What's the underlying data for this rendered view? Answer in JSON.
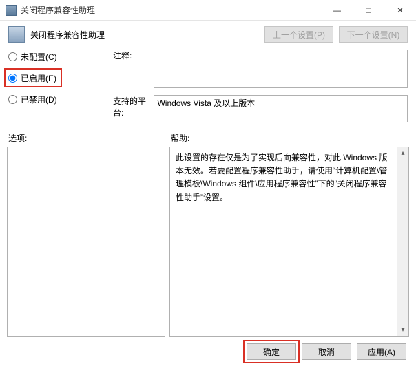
{
  "window": {
    "title": "关闭程序兼容性助理"
  },
  "header": {
    "title": "关闭程序兼容性助理",
    "prev": "上一个设置(P)",
    "next": "下一个设置(N)"
  },
  "radios": {
    "not_configured": "未配置(C)",
    "enabled": "已启用(E)",
    "disabled": "已禁用(D)",
    "selected": "enabled"
  },
  "fields": {
    "comment_label": "注释:",
    "comment_value": "",
    "platform_label": "支持的平台:",
    "platform_value": "Windows Vista 及以上版本"
  },
  "labels": {
    "options": "选项:",
    "help": "帮助:"
  },
  "help_text": "此设置的存在仅是为了实现后向兼容性，对此 Windows 版本无效。若要配置程序兼容性助手，请使用“计算机配置\\管理模板\\Windows 组件\\应用程序兼容性”下的“关闭程序兼容性助手”设置。",
  "buttons": {
    "ok": "确定",
    "cancel": "取消",
    "apply": "应用(A)"
  }
}
